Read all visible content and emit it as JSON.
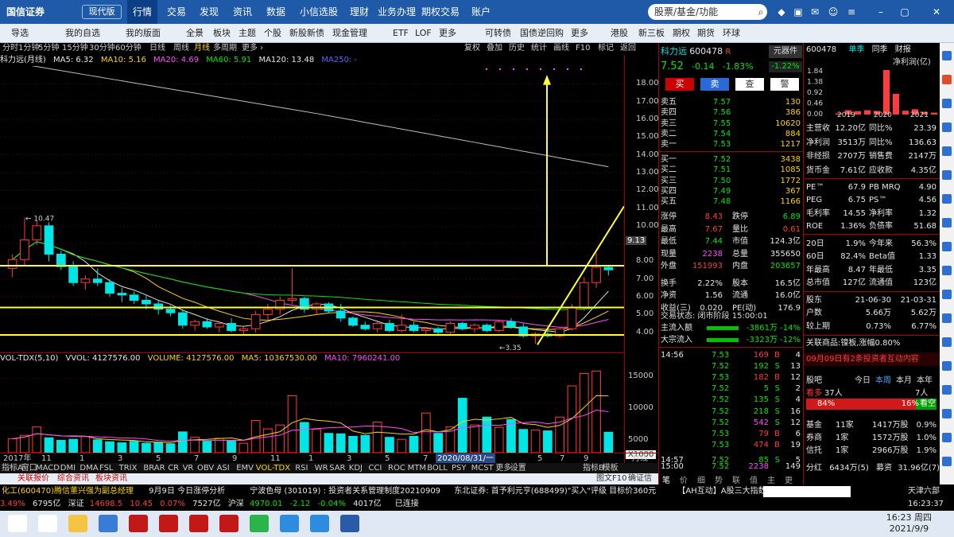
{
  "topbar": {
    "logo": "国信证券",
    "version": "现代版",
    "nav": [
      "行情",
      "交易",
      "发现",
      "资讯",
      "数据",
      "小信选股",
      "理财",
      "业务办理",
      "期权交易",
      "账户"
    ],
    "search_placeholder": "股票/基金/功能"
  },
  "toolbar": {
    "items": [
      "导选",
      "我的自选",
      "我的版面",
      "全景",
      "板块",
      "主题",
      "个股",
      "新股新债",
      "现金管理",
      "ETF",
      "LOF",
      "更多",
      "可转债",
      "国债逆回购",
      "更多",
      "港股",
      "新三板",
      "期权",
      "期货",
      "环球"
    ]
  },
  "periods": [
    "分时",
    "1分钟",
    "5分钟",
    "15分钟",
    "30分钟",
    "60分钟",
    "日线",
    "周线",
    "月线",
    "多周期",
    "更多 ›"
  ],
  "period_active": "月线",
  "chart_buttons": [
    "复权",
    "叠加",
    "历史",
    "统计",
    "画线",
    "F10",
    "标记",
    "返回"
  ],
  "main_title": {
    "name": "科力远(月线)",
    "ma5": "MA5: 6.32",
    "ma10": "MA10: 5.16",
    "ma20": "MA20: 4.69",
    "ma60": "MA60: 5.91",
    "ma120": "MA120: 13.48",
    "ma250": "MA250: -"
  },
  "price_axis": [
    "18.00",
    "17.00",
    "16.00",
    "15.00",
    "14.00",
    "13.00",
    "12.00",
    "11.00",
    "10.00",
    "9.13",
    "8.00",
    "7.00",
    "6.00",
    "5.00",
    "4.00"
  ],
  "vol_axis": [
    "15000",
    "10000",
    "5000",
    "X1000"
  ],
  "annotations": {
    "high": "10.47",
    "low": "3.35"
  },
  "vol_title": {
    "name": "VOL-TDX(5,10)",
    "vvol": "VVOL: 4127576.00",
    "volume": "VOLUME: 4127576.00",
    "ma5": "MA5: 10367530.00",
    "ma10": "MA10: 7960241.00"
  },
  "x_axis": [
    "2017年",
    "11",
    "1",
    "3",
    "5",
    "7",
    "9",
    "11",
    "1",
    "3",
    "5",
    "7",
    "9",
    "11",
    "2020/08/31/一",
    "5",
    "7",
    "9",
    "月线"
  ],
  "indicators": [
    "指标A",
    "窗口",
    "MACD",
    "DMI",
    "DMA",
    "FSL",
    "TRIX",
    "BRAR",
    "CR",
    "VR",
    "OBV",
    "ASI",
    "EMV",
    "VOL-TDX",
    "RSI",
    "WR",
    "SAR",
    "KDJ",
    "CCI",
    "ROC",
    "MTM",
    "BOLL",
    "PSY",
    "MCST",
    "更多",
    "设置",
    "指标B",
    "模板"
  ],
  "indicator_active": "VOL-TDX",
  "subtabs": [
    "关联报价",
    "综合资讯",
    "板块资讯",
    "图文F10",
    "确证信息"
  ],
  "stock": {
    "name": "科力远",
    "code": "600478",
    "tag": "R",
    "price": "7.52",
    "change": "-0.14",
    "pct": "-1.83%",
    "sector": "元器件",
    "sector_pct": "-1.22%",
    "buttons": [
      "买",
      "卖",
      "查",
      "警"
    ]
  },
  "asks": [
    {
      "label": "卖五",
      "price": "7.57",
      "vol": "130"
    },
    {
      "label": "卖四",
      "price": "7.56",
      "vol": "386"
    },
    {
      "label": "卖三",
      "price": "7.55",
      "vol": "10620"
    },
    {
      "label": "卖二",
      "price": "7.54",
      "vol": "884"
    },
    {
      "label": "卖一",
      "price": "7.53",
      "vol": "1217"
    }
  ],
  "bids": [
    {
      "label": "买一",
      "price": "7.52",
      "vol": "3438"
    },
    {
      "label": "买二",
      "price": "7.51",
      "vol": "1085"
    },
    {
      "label": "买三",
      "price": "7.50",
      "vol": "1772"
    },
    {
      "label": "买四",
      "price": "7.49",
      "vol": "367"
    },
    {
      "label": "买五",
      "price": "7.48",
      "vol": "1166"
    }
  ],
  "stats": [
    {
      "k1": "涨停",
      "v1": "8.43",
      "k2": "跌停",
      "v2": "6.89"
    },
    {
      "k1": "最高",
      "v1": "7.67",
      "k2": "量比",
      "v2": "0.61"
    },
    {
      "k1": "最低",
      "v1": "7.44",
      "k2": "市值",
      "v2": "124.3亿"
    },
    {
      "k1": "现量",
      "v1": "2238",
      "k2": "总量",
      "v2": "355650"
    },
    {
      "k1": "外盘",
      "v1": "151993",
      "k2": "内盘",
      "v2": "203657"
    },
    {
      "k1": "换手",
      "v1": "2.22%",
      "k2": "股本",
      "v2": "16.5亿"
    },
    {
      "k1": "净资",
      "v1": "1.56",
      "k2": "流通",
      "v2": "16.0亿"
    },
    {
      "k1": "收益(三)",
      "v1": "0.020",
      "k2": "PE(动)",
      "v2": "176.9"
    }
  ],
  "trade_status": "交易状态: 闭市阶段 15:00:01",
  "flows": [
    {
      "label": "主流入额",
      "value": "-3861万",
      "pct": "-14%"
    },
    {
      "label": "大宗流入",
      "value": "-3323万",
      "pct": "-12%"
    }
  ],
  "ticks": [
    {
      "time": "14:56",
      "price": "7.53",
      "vol": "169",
      "side": "B",
      "n": "4"
    },
    {
      "time": "",
      "price": "7.52",
      "vol": "192",
      "side": "S",
      "n": "13"
    },
    {
      "time": "",
      "price": "7.53",
      "vol": "182",
      "side": "B",
      "n": "12"
    },
    {
      "time": "",
      "price": "7.52",
      "vol": "5",
      "side": "S",
      "n": "2"
    },
    {
      "time": "",
      "price": "7.52",
      "vol": "135",
      "side": "S",
      "n": "4"
    },
    {
      "time": "",
      "price": "7.52",
      "vol": "218",
      "side": "S",
      "n": "16"
    },
    {
      "time": "",
      "price": "7.52",
      "vol": "542",
      "side": "S",
      "n": "12"
    },
    {
      "time": "",
      "price": "7.53",
      "vol": "79",
      "side": "B",
      "n": "6"
    },
    {
      "time": "",
      "price": "7.53",
      "vol": "474",
      "side": "B",
      "n": "19"
    },
    {
      "time": "14:57",
      "price": "7.52",
      "vol": "85",
      "side": "S",
      "n": "5"
    },
    {
      "time": "15:00",
      "price": "7.52",
      "vol": "2238",
      "side": "",
      "n": "149"
    }
  ],
  "rp1_tabs": [
    "笔",
    "价",
    "细",
    "势",
    "联",
    "值",
    "主",
    "更"
  ],
  "fin": {
    "code": "600478",
    "tabs": [
      "单季",
      "同季",
      "财报"
    ],
    "metric": "净利润(亿)",
    "scale": [
      "1.84",
      "1.38",
      "0.92",
      "0.46",
      "0.00"
    ],
    "years": [
      "2019",
      "2020",
      "2021"
    ],
    "bars": [
      0.05,
      0.18,
      0.14,
      0.18,
      0.15,
      1.84,
      0.86,
      0.16,
      0.22,
      0.11,
      0.08
    ]
  },
  "fin_rows": [
    {
      "k1": "主营收",
      "v1": "12.20亿",
      "k2": "同比%",
      "v2": "23.39"
    },
    {
      "k1": "净利润",
      "v1": "3513万",
      "k2": "同比%",
      "v2": "136.63"
    },
    {
      "k1": "非经损",
      "v1": "2707万",
      "k2": "销售费",
      "v2": "2147万"
    },
    {
      "k1": "货币金",
      "v1": "7.61亿",
      "k2": "应收款",
      "v2": "4.35亿"
    }
  ],
  "val_rows": [
    {
      "k1": "PE™",
      "v1": "67.9",
      "k2": "PB MRQ",
      "v2": "4.90"
    },
    {
      "k1": "PEG",
      "v1": "6.75",
      "k2": "PS™",
      "v2": "4.56"
    },
    {
      "k1": "毛利率",
      "v1": "14.55",
      "k2": "净利率",
      "v2": "1.32"
    },
    {
      "k1": "ROE",
      "v1": "1.36%",
      "k2": "负债率",
      "v2": "51.68"
    }
  ],
  "perf_rows": [
    {
      "k1": "20日",
      "v1": "1.9%",
      "k2": "今年来",
      "v2": "56.3%"
    },
    {
      "k1": "60日",
      "v1": "82.4%",
      "k2": "Beta值",
      "v2": "1.33"
    },
    {
      "k1": "年最高",
      "v1": "8.47",
      "k2": "年最低",
      "v2": "3.35"
    },
    {
      "k1": "总市值",
      "v1": "127亿",
      "k2": "流通值",
      "v2": "123亿"
    }
  ],
  "holder_rows": [
    {
      "k1": "股东",
      "v1": "21-06-30",
      "v2": "21-03-31"
    },
    {
      "k1": "户数",
      "v1": "5.66万",
      "v2": "5.62万"
    },
    {
      "k1": "较上期",
      "v1": "0.73%",
      "v2": "6.77%"
    }
  ],
  "related": "关联商品:镍板,涨幅0.80%",
  "event": "09月09日有2条投资者互动内容",
  "sentiment": {
    "label": "股吧",
    "tabs": [
      "今日",
      "本周",
      "本月",
      "本年"
    ],
    "bull_label": "看多",
    "bull_count": "37人",
    "bear_count": "7人",
    "bull_pct": "84%",
    "bear_pct": "16%",
    "bear_label": "看空"
  },
  "inst_rows": [
    {
      "k": "基金",
      "a": "11家",
      "b": "1417万股",
      "c": "0.9%"
    },
    {
      "k": "券商",
      "a": "1家",
      "b": "1572万股",
      "c": "1.0%"
    },
    {
      "k": "信托",
      "a": "1家",
      "b": "2966万股",
      "c": "1.9%"
    }
  ],
  "bottom_row": {
    "k1": "分红",
    "v1": "6434万(5)",
    "k2": "募资",
    "v2": "31.96亿(7)"
  },
  "ticker1": {
    "a": "化工(600470)腾信董兴强为副总经理",
    "b": "9月9日 今日涨停分析",
    "c": "宁波色母 (301019) : 投资者关系管理制度20210909",
    "d": "东北证券: 首予利元亨(688499)\"买入\"评级 目标价360元",
    "e": "【AH互动】A股三大指数午后回落",
    "f": "天津六部"
  },
  "ticker2": {
    "a": "3.49%",
    "b": "6795亿",
    "c": "深证",
    "d": "14698.5",
    "e": "10.45",
    "f": "0.07%",
    "g": "7527亿",
    "h": "沪深",
    "i": "4970.01",
    "j": "-2.12",
    "k": "-0.04%",
    "l": "4017亿",
    "m": "已连接",
    "n": "16:23:37"
  },
  "clock": {
    "time": "16:23 周四",
    "date": "2021/9/9"
  },
  "taskbar_icons": [
    "search-icon",
    "taskview-icon",
    "explorer-icon",
    "store-icon",
    "trading-app-icon",
    "trading-app-icon",
    "trading-app-icon",
    "trading-app-icon",
    "wechat-icon",
    "browser-icon",
    "browser-icon",
    "word-icon"
  ],
  "chart_data": [
    {
      "type": "candlestick",
      "title": "科力远(月线)",
      "ylim": [
        3.0,
        19.0
      ],
      "ohlc": [
        [
          7.6,
          8.4,
          7.1,
          8.1
        ],
        [
          8.1,
          10.47,
          7.8,
          9.2
        ],
        [
          9.2,
          10.3,
          8.9,
          10.0
        ],
        [
          10.0,
          10.2,
          8.0,
          8.4
        ],
        [
          8.4,
          8.6,
          7.5,
          7.7
        ],
        [
          7.7,
          8.0,
          6.6,
          6.8
        ],
        [
          6.8,
          7.2,
          6.4,
          7.0
        ],
        [
          7.0,
          7.6,
          6.6,
          6.8
        ],
        [
          6.8,
          7.0,
          6.0,
          6.2
        ],
        [
          6.2,
          6.5,
          5.7,
          6.1
        ],
        [
          6.1,
          6.3,
          5.6,
          5.8
        ],
        [
          5.8,
          6.1,
          5.3,
          5.6
        ],
        [
          5.6,
          5.8,
          5.0,
          5.3
        ],
        [
          5.3,
          5.5,
          4.9,
          5.1
        ],
        [
          5.1,
          5.3,
          4.2,
          4.4
        ],
        [
          4.4,
          4.7,
          4.1,
          4.6
        ],
        [
          4.6,
          4.8,
          4.2,
          4.3
        ],
        [
          4.3,
          4.6,
          4.0,
          4.5
        ],
        [
          4.5,
          4.8,
          4.0,
          4.1
        ],
        [
          4.1,
          4.3,
          3.9,
          4.2
        ],
        [
          4.2,
          5.2,
          4.0,
          5.0
        ],
        [
          5.0,
          5.6,
          4.6,
          5.3
        ],
        [
          5.3,
          6.0,
          5.0,
          5.8
        ],
        [
          5.8,
          7.6,
          5.6,
          5.9
        ],
        [
          5.9,
          6.0,
          5.1,
          5.3
        ],
        [
          5.3,
          5.7,
          5.0,
          5.6
        ],
        [
          5.6,
          5.7,
          5.1,
          5.2
        ],
        [
          5.2,
          5.6,
          4.6,
          4.8
        ],
        [
          4.8,
          4.9,
          4.3,
          4.4
        ],
        [
          4.4,
          4.6,
          4.1,
          4.2
        ],
        [
          4.2,
          4.6,
          4.0,
          4.5
        ],
        [
          4.5,
          4.7,
          4.0,
          4.1
        ],
        [
          4.1,
          5.0,
          4.0,
          4.4
        ],
        [
          4.4,
          4.6,
          4.0,
          4.1
        ],
        [
          4.1,
          4.3,
          3.8,
          4.2
        ],
        [
          4.2,
          4.3,
          3.8,
          4.0
        ],
        [
          4.0,
          4.6,
          3.9,
          4.5
        ],
        [
          4.5,
          4.6,
          4.1,
          4.2
        ],
        [
          4.2,
          4.5,
          4.0,
          4.4
        ],
        [
          4.4,
          4.5,
          4.0,
          4.1
        ],
        [
          4.1,
          4.7,
          4.0,
          4.6
        ],
        [
          4.6,
          4.8,
          4.2,
          4.3
        ],
        [
          4.3,
          4.5,
          3.7,
          3.8
        ],
        [
          3.8,
          4.0,
          3.35,
          3.9
        ],
        [
          3.9,
          4.1,
          3.7,
          3.8
        ],
        [
          3.8,
          4.3,
          3.7,
          4.2
        ],
        [
          4.2,
          5.6,
          4.1,
          5.4
        ],
        [
          5.4,
          7.1,
          5.2,
          6.8
        ],
        [
          6.8,
          8.47,
          6.5,
          7.66
        ],
        [
          7.66,
          7.8,
          7.2,
          7.52
        ]
      ]
    },
    {
      "type": "bar",
      "title": "VOL-TDX(5,10)",
      "ylim": [
        0,
        18000
      ],
      "values": [
        2800,
        3500,
        5200,
        3000,
        2500,
        2700,
        3300,
        2600,
        2200,
        2000,
        2300,
        1900,
        2100,
        1800,
        4200,
        3100,
        2300,
        2900,
        2400,
        1900,
        6500,
        4800,
        5600,
        11500,
        6100,
        4700,
        3900,
        3800,
        3300,
        3500,
        6200,
        3100,
        2700,
        3300,
        8000,
        3900,
        5200,
        11000,
        5600,
        7200,
        5100,
        6700,
        4700,
        4600,
        4400,
        7200,
        13500,
        16000,
        16500,
        4127.576
      ]
    }
  ]
}
